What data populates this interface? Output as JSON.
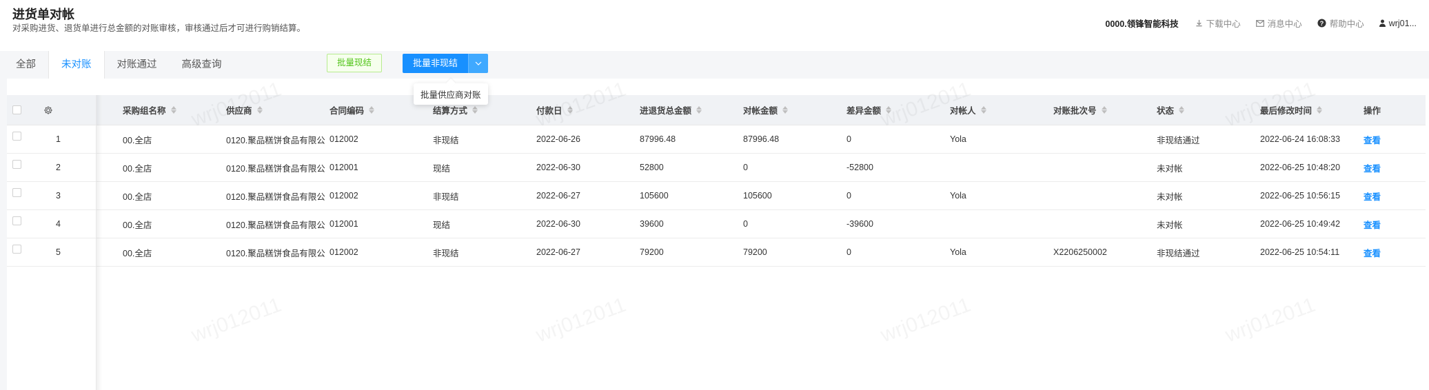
{
  "header": {
    "title": "进货单对帐",
    "subtitle": "对采购进货、退货单进行总金额的对账审核，审核通过后才可进行购销结算。",
    "company": "0000.领锋智能科技",
    "download_label": "下载中心",
    "message_label": "消息中心",
    "help_label": "帮助中心",
    "user_label": "wrj01..."
  },
  "tabs": [
    {
      "label": "全部"
    },
    {
      "label": "未对账"
    },
    {
      "label": "对账通过"
    },
    {
      "label": "高级查询"
    }
  ],
  "active_tab": "未对账",
  "toolbar": {
    "batch_cash_label": "批量现结",
    "batch_noncash_label": "批量非现结",
    "tooltip": "批量供应商对账"
  },
  "watermark": "wrj012011",
  "table": {
    "columns": [
      "采购组名称",
      "供应商",
      "合同编码",
      "结算方式",
      "付款日",
      "进退货总金额",
      "对帐金额",
      "差异金额",
      "对帐人",
      "对账批次号",
      "状态",
      "最后修改时间",
      "操作"
    ],
    "rows": [
      {
        "index": "1",
        "group": "00.全店",
        "supplier": "0120.聚品糕饼食品有限公",
        "contract": "012002",
        "settle": "非现结",
        "pay_date": "2022-06-26",
        "total": "87996.48",
        "recon": "87996.48",
        "diff": "0",
        "person": "Yola",
        "batch": "",
        "status": "非现结通过",
        "modified": "2022-06-24 16:08:33",
        "action": "查看"
      },
      {
        "index": "2",
        "group": "00.全店",
        "supplier": "0120.聚品糕饼食品有限公",
        "contract": "012001",
        "settle": "现结",
        "pay_date": "2022-06-30",
        "total": "52800",
        "recon": "0",
        "diff": "-52800",
        "person": "",
        "batch": "",
        "status": "未对帐",
        "modified": "2022-06-25 10:48:20",
        "action": "查看"
      },
      {
        "index": "3",
        "group": "00.全店",
        "supplier": "0120.聚品糕饼食品有限公",
        "contract": "012002",
        "settle": "非现结",
        "pay_date": "2022-06-27",
        "total": "105600",
        "recon": "105600",
        "diff": "0",
        "person": "Yola",
        "batch": "",
        "status": "未对帐",
        "modified": "2022-06-25 10:56:15",
        "action": "查看"
      },
      {
        "index": "4",
        "group": "00.全店",
        "supplier": "0120.聚品糕饼食品有限公",
        "contract": "012001",
        "settle": "现结",
        "pay_date": "2022-06-30",
        "total": "39600",
        "recon": "0",
        "diff": "-39600",
        "person": "",
        "batch": "",
        "status": "未对帐",
        "modified": "2022-06-25 10:49:42",
        "action": "查看"
      },
      {
        "index": "5",
        "group": "00.全店",
        "supplier": "0120.聚品糕饼食品有限公",
        "contract": "012002",
        "settle": "非现结",
        "pay_date": "2022-06-27",
        "total": "79200",
        "recon": "79200",
        "diff": "0",
        "person": "Yola",
        "batch": "X2206250002",
        "status": "非现结通过",
        "modified": "2022-06-25 10:54:11",
        "action": "查看"
      }
    ]
  },
  "colors": {
    "accent": "#1890ff",
    "success_text": "#52c41a",
    "header_bg": "#f0f2f5"
  }
}
